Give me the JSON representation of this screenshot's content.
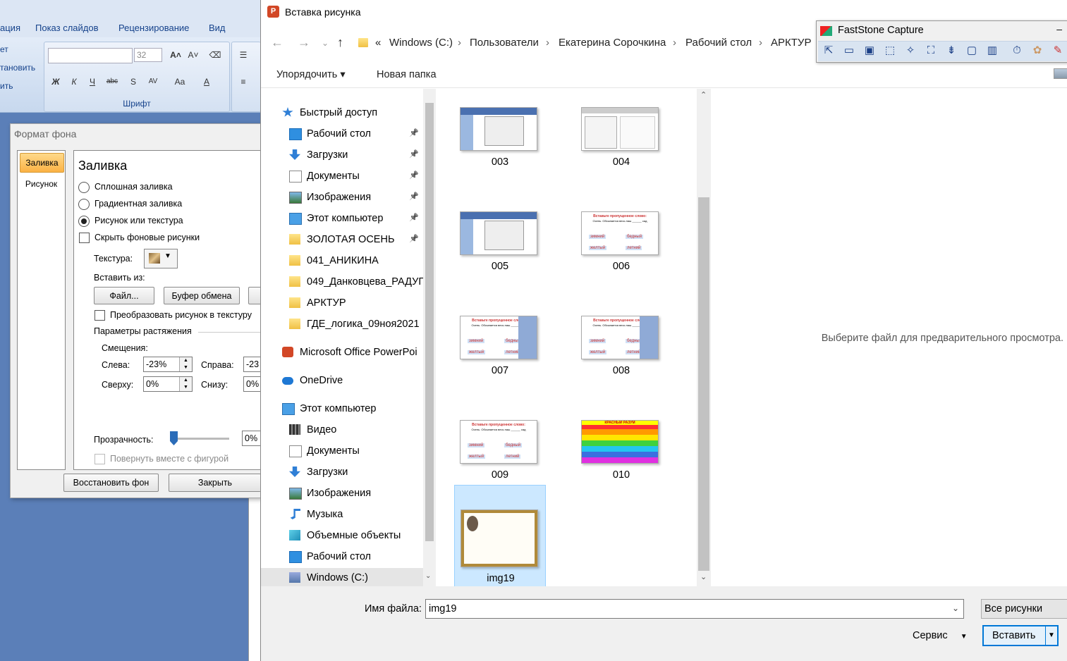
{
  "ppt": {
    "tabs": [
      "ация",
      "Показ слайдов",
      "Рецензирование",
      "Вид"
    ],
    "left_edge": [
      "ет",
      "тановить",
      "ить"
    ],
    "font_size": "32",
    "group_label": "Шрифт"
  },
  "format_dialog": {
    "title": "Формат фона",
    "tabs": [
      "Заливка",
      "Рисунок"
    ],
    "heading": "Заливка",
    "options": [
      "Сплошная заливка",
      "Градиентная заливка",
      "Рисунок или текстура"
    ],
    "selected_option": "Рисунок или текстура",
    "hide_bg": "Скрыть фоновые рисунки",
    "texture_label": "Текстура:",
    "insert_from": "Вставить из:",
    "btn_file": "Файл...",
    "btn_clipboard": "Буфер обмена",
    "convert_texture": "Преобразовать рисунок в текстуру",
    "stretch": "Параметры растяжения",
    "offsets": "Смещения:",
    "left_label": "Слева:",
    "left_val": "-23%",
    "right_label": "Справа:",
    "right_val": "-23",
    "top_label": "Сверху:",
    "top_val": "0%",
    "bottom_label": "Снизу:",
    "bottom_val": "0%",
    "transparency_label": "Прозрачность:",
    "transparency_val": "0%",
    "rotate": "Повернуть вместе с фигурой",
    "btn_restore": "Восстановить фон",
    "btn_close": "Закрыть"
  },
  "insert_dialog": {
    "title": "Вставка рисунка",
    "breadcrumb": [
      "«",
      "Windows (C:)",
      "Пользователи",
      "Екатерина Сорочкина",
      "Рабочий стол",
      "АРКТУР"
    ],
    "toolbar": {
      "organize": "Упорядочить ▾",
      "new_folder": "Новая папка"
    },
    "nav": [
      {
        "label": "Быстрый доступ",
        "icon": "star-icon",
        "pinned": false
      },
      {
        "label": "Рабочий стол",
        "icon": "desktop-icon",
        "pinned": true
      },
      {
        "label": "Загрузки",
        "icon": "download-icon",
        "pinned": true
      },
      {
        "label": "Документы",
        "icon": "document-icon",
        "pinned": true
      },
      {
        "label": "Изображения",
        "icon": "pictures-icon",
        "pinned": true
      },
      {
        "label": "Этот компьютер",
        "icon": "computer-icon",
        "pinned": true
      },
      {
        "label": "ЗОЛОТАЯ ОСЕНЬ",
        "icon": "folder-icon",
        "pinned": true
      },
      {
        "label": "041_АНИКИНА",
        "icon": "folder-icon",
        "pinned": false
      },
      {
        "label": "049_Данковцева_РАДУГ",
        "icon": "folder-icon",
        "pinned": false
      },
      {
        "label": "АРКТУР",
        "icon": "folder-icon",
        "pinned": false
      },
      {
        "label": "ГДЕ_логика_09ноя2021",
        "icon": "folder-icon",
        "pinned": false
      },
      {
        "label": "Microsoft Office PowerPoi",
        "icon": "powerpoint-icon",
        "pinned": false
      },
      {
        "label": "OneDrive",
        "icon": "cloud-icon",
        "pinned": false
      },
      {
        "label": "Этот компьютер",
        "icon": "computer-icon",
        "pinned": false
      },
      {
        "label": "Видео",
        "icon": "video-icon",
        "pinned": false
      },
      {
        "label": "Документы",
        "icon": "document-icon",
        "pinned": false
      },
      {
        "label": "Загрузки",
        "icon": "download-icon",
        "pinned": false
      },
      {
        "label": "Изображения",
        "icon": "pictures-icon",
        "pinned": false
      },
      {
        "label": "Музыка",
        "icon": "music-icon",
        "pinned": false
      },
      {
        "label": "Объемные объекты",
        "icon": "cube-icon",
        "pinned": false
      },
      {
        "label": "Рабочий стол",
        "icon": "desktop-icon",
        "pinned": false
      },
      {
        "label": "Windows (C:)",
        "icon": "drive-icon",
        "pinned": false
      }
    ],
    "files": [
      {
        "name": "003",
        "kind": "screen"
      },
      {
        "name": "004",
        "kind": "dialog"
      },
      {
        "name": "005",
        "kind": "screen2"
      },
      {
        "name": "006",
        "kind": "words"
      },
      {
        "name": "007",
        "kind": "words-screen"
      },
      {
        "name": "008",
        "kind": "words-screen"
      },
      {
        "name": "009",
        "kind": "words"
      },
      {
        "name": "010",
        "kind": "table"
      },
      {
        "name": "img19",
        "kind": "frame"
      }
    ],
    "thumb_text": {
      "heading": "Вставьте пропущенное слово:",
      "line": "Осень. Обсыпается весь наш ______ сад",
      "words": [
        "зимний",
        "бедный",
        "желтый",
        "летний"
      ],
      "table_title": "КРАСНЫЙ РАЗУМ"
    },
    "selected_file": "img19",
    "preview_msg": "Выберите файл для предварительного просмотра.",
    "filename_label": "Имя файла:",
    "filename_value": "img19",
    "filetype": "Все рисунки",
    "service": "Сервис",
    "insert_btn": "Вставить"
  },
  "faststone": {
    "title": "FastStone Capture"
  }
}
